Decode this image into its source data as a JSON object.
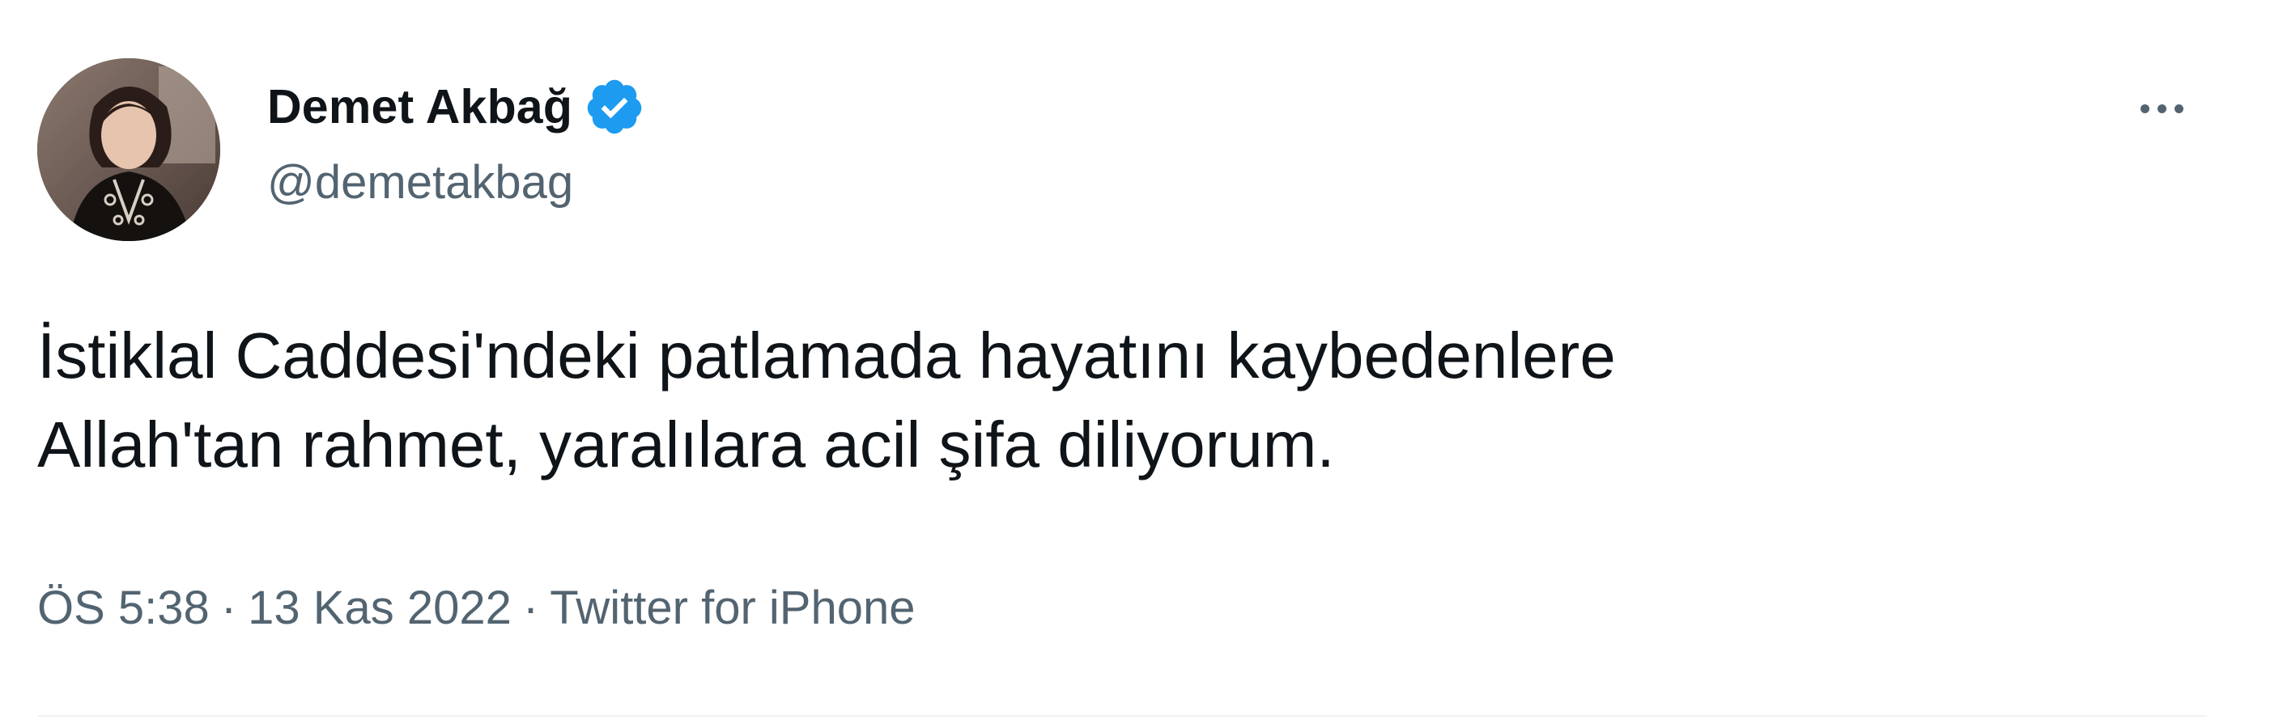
{
  "tweet": {
    "author": {
      "display_name": "Demet Akbağ",
      "handle": "@demetakbag",
      "verified": true
    },
    "text": "İstiklal Caddesi'ndeki patlamada hayatını kaybedenlere\nAllah'tan rahmet, yaralılara acil şifa diliyorum.",
    "time": "ÖS 5:38",
    "separator": "·",
    "date": "13 Kas 2022",
    "source": "Twitter for iPhone"
  },
  "icons": {
    "verified": "verified-badge-icon",
    "more": "more-dots-icon"
  },
  "colors": {
    "primary_text": "#0f1419",
    "secondary_text": "#536471",
    "verified_blue": "#1d9bf0",
    "divider": "#eff3f4"
  }
}
